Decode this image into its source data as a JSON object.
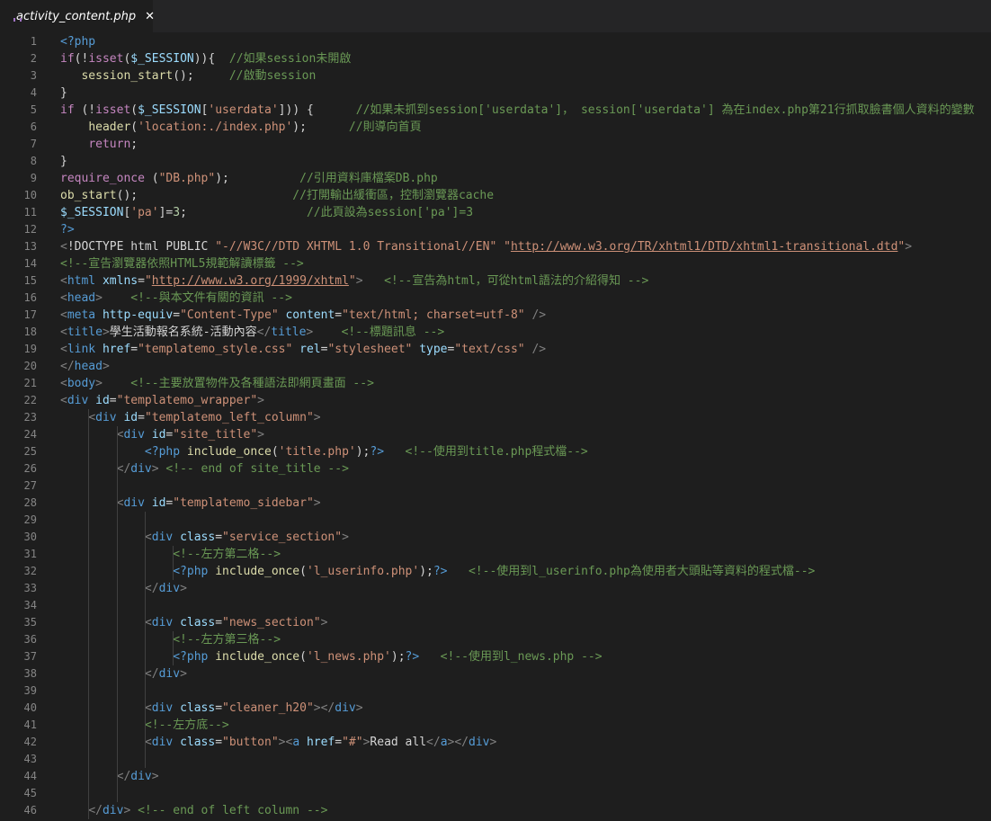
{
  "tab": {
    "title": "activity_content.php",
    "close": "✕",
    "icon": "php-elephant-icon"
  },
  "colors": {
    "background": "#1e1e1e",
    "tabbar": "#252526",
    "comment": "#6a9955",
    "string": "#ce9178",
    "keyword": "#c586c0"
  },
  "lines": [
    {
      "n": "1",
      "segs": [
        [
          "ph",
          "<?php"
        ]
      ]
    },
    {
      "n": "2",
      "segs": [
        [
          "k",
          "if"
        ],
        [
          "p",
          "(!"
        ],
        [
          "k",
          "isset"
        ],
        [
          "p",
          "("
        ],
        [
          "v",
          "$_SESSION"
        ],
        [
          "p",
          "))"
        ],
        [
          "p",
          "{  "
        ],
        [
          "c",
          "//如果session未開啟"
        ]
      ]
    },
    {
      "n": "3",
      "segs": [
        [
          "p",
          "   "
        ],
        [
          "fn",
          "session_start"
        ],
        [
          "p",
          "();     "
        ],
        [
          "c",
          "//啟動session"
        ]
      ]
    },
    {
      "n": "4",
      "segs": [
        [
          "p",
          "}"
        ]
      ]
    },
    {
      "n": "5",
      "segs": [
        [
          "k",
          "if"
        ],
        [
          "p",
          " (!"
        ],
        [
          "k",
          "isset"
        ],
        [
          "p",
          "("
        ],
        [
          "v",
          "$_SESSION"
        ],
        [
          "p",
          "["
        ],
        [
          "s",
          "'userdata'"
        ],
        [
          "p",
          "])) {      "
        ],
        [
          "c",
          "//如果未抓到session['userdata']， session['userdata'] 為在index.php第21行抓取臉書個人資料的變數"
        ]
      ]
    },
    {
      "n": "6",
      "segs": [
        [
          "p",
          "    "
        ],
        [
          "fn",
          "header"
        ],
        [
          "p",
          "("
        ],
        [
          "s",
          "'location:./index.php'"
        ],
        [
          "p",
          ");      "
        ],
        [
          "c",
          "//則導向首頁"
        ]
      ]
    },
    {
      "n": "7",
      "segs": [
        [
          "p",
          "    "
        ],
        [
          "k",
          "return"
        ],
        [
          "p",
          ";"
        ]
      ]
    },
    {
      "n": "8",
      "segs": [
        [
          "p",
          "}"
        ]
      ]
    },
    {
      "n": "9",
      "segs": [
        [
          "k",
          "require_once"
        ],
        [
          "p",
          " ("
        ],
        [
          "s",
          "\"DB.php\""
        ],
        [
          "p",
          ");          "
        ],
        [
          "c",
          "//引用資料庫檔案DB.php"
        ]
      ]
    },
    {
      "n": "10",
      "segs": [
        [
          "fn",
          "ob_start"
        ],
        [
          "p",
          "();                      "
        ],
        [
          "c",
          "//打開輸出緩衝區，控制瀏覽器cache"
        ]
      ]
    },
    {
      "n": "11",
      "segs": [
        [
          "v",
          "$_SESSION"
        ],
        [
          "p",
          "["
        ],
        [
          "s",
          "'pa'"
        ],
        [
          "p",
          "]="
        ],
        [
          "n",
          "3"
        ],
        [
          "p",
          ";                 "
        ],
        [
          "c",
          "//此頁設為session['pa']=3"
        ]
      ]
    },
    {
      "n": "12",
      "segs": [
        [
          "ph",
          "?>"
        ]
      ]
    },
    {
      "n": "13",
      "segs": [
        [
          "g",
          "<"
        ],
        [
          "p",
          "!DOCTYPE html PUBLIC "
        ],
        [
          "s",
          "\"-//W3C//DTD XHTML 1.0 Transitional//EN\""
        ],
        [
          "p",
          " "
        ],
        [
          "s",
          "\""
        ],
        [
          "su",
          "http://www.w3.org/TR/xhtml1/DTD/xhtml1-transitional.dtd"
        ],
        [
          "s",
          "\""
        ],
        [
          "g",
          ">"
        ]
      ]
    },
    {
      "n": "14",
      "segs": [
        [
          "c",
          "<!--宣告瀏覽器依照HTML5規範解讀標籤 -->"
        ]
      ]
    },
    {
      "n": "15",
      "segs": [
        [
          "g",
          "<"
        ],
        [
          "t",
          "html"
        ],
        [
          "p",
          " "
        ],
        [
          "a",
          "xmlns"
        ],
        [
          "p",
          "="
        ],
        [
          "s",
          "\""
        ],
        [
          "su",
          "http://www.w3.org/1999/xhtml"
        ],
        [
          "s",
          "\""
        ],
        [
          "g",
          ">"
        ],
        [
          "p",
          "   "
        ],
        [
          "c",
          "<!--宣告為html，可從html語法的介紹得知 -->"
        ]
      ]
    },
    {
      "n": "16",
      "segs": [
        [
          "g",
          "<"
        ],
        [
          "t",
          "head"
        ],
        [
          "g",
          ">"
        ],
        [
          "p",
          "    "
        ],
        [
          "c",
          "<!--與本文件有關的資訊 -->"
        ]
      ]
    },
    {
      "n": "17",
      "segs": [
        [
          "g",
          "<"
        ],
        [
          "t",
          "meta"
        ],
        [
          "p",
          " "
        ],
        [
          "a",
          "http-equiv"
        ],
        [
          "p",
          "="
        ],
        [
          "s",
          "\"Content-Type\""
        ],
        [
          "p",
          " "
        ],
        [
          "a",
          "content"
        ],
        [
          "p",
          "="
        ],
        [
          "s",
          "\"text/html; charset=utf-8\""
        ],
        [
          "p",
          " "
        ],
        [
          "g",
          "/>"
        ]
      ]
    },
    {
      "n": "18",
      "segs": [
        [
          "g",
          "<"
        ],
        [
          "t",
          "title"
        ],
        [
          "g",
          ">"
        ],
        [
          "p",
          "學生活動報名系統-活動內容"
        ],
        [
          "g",
          "</"
        ],
        [
          "t",
          "title"
        ],
        [
          "g",
          ">"
        ],
        [
          "p",
          "    "
        ],
        [
          "c",
          "<!--標題訊息 -->"
        ]
      ]
    },
    {
      "n": "19",
      "segs": [
        [
          "g",
          "<"
        ],
        [
          "t",
          "link"
        ],
        [
          "p",
          " "
        ],
        [
          "a",
          "href"
        ],
        [
          "p",
          "="
        ],
        [
          "s",
          "\"templatemo_style.css\""
        ],
        [
          "p",
          " "
        ],
        [
          "a",
          "rel"
        ],
        [
          "p",
          "="
        ],
        [
          "s",
          "\"stylesheet\""
        ],
        [
          "p",
          " "
        ],
        [
          "a",
          "type"
        ],
        [
          "p",
          "="
        ],
        [
          "s",
          "\"text/css\""
        ],
        [
          "p",
          " "
        ],
        [
          "g",
          "/>"
        ]
      ]
    },
    {
      "n": "20",
      "segs": [
        [
          "g",
          "</"
        ],
        [
          "t",
          "head"
        ],
        [
          "g",
          ">"
        ]
      ]
    },
    {
      "n": "21",
      "segs": [
        [
          "g",
          "<"
        ],
        [
          "t",
          "body"
        ],
        [
          "g",
          ">"
        ],
        [
          "p",
          "    "
        ],
        [
          "c",
          "<!--主要放置物件及各種語法即網頁畫面 -->"
        ]
      ]
    },
    {
      "n": "22",
      "segs": [
        [
          "g",
          "<"
        ],
        [
          "t",
          "div"
        ],
        [
          "p",
          " "
        ],
        [
          "a",
          "id"
        ],
        [
          "p",
          "="
        ],
        [
          "s",
          "\"templatemo_wrapper\""
        ],
        [
          "g",
          ">"
        ]
      ]
    },
    {
      "n": "23",
      "segs": [
        [
          "p",
          "    "
        ],
        [
          "g",
          "<"
        ],
        [
          "t",
          "div"
        ],
        [
          "p",
          " "
        ],
        [
          "a",
          "id"
        ],
        [
          "p",
          "="
        ],
        [
          "s",
          "\"templatemo_left_column\""
        ],
        [
          "g",
          ">"
        ]
      ]
    },
    {
      "n": "24",
      "segs": [
        [
          "p",
          "        "
        ],
        [
          "g",
          "<"
        ],
        [
          "t",
          "div"
        ],
        [
          "p",
          " "
        ],
        [
          "a",
          "id"
        ],
        [
          "p",
          "="
        ],
        [
          "s",
          "\"site_title\""
        ],
        [
          "g",
          ">"
        ]
      ]
    },
    {
      "n": "25",
      "segs": [
        [
          "p",
          "            "
        ],
        [
          "ph",
          "<?php"
        ],
        [
          "p",
          " "
        ],
        [
          "fn",
          "include_once"
        ],
        [
          "p",
          "("
        ],
        [
          "s",
          "'title.php'"
        ],
        [
          "p",
          ");"
        ],
        [
          "ph",
          "?>"
        ],
        [
          "p",
          "   "
        ],
        [
          "c",
          "<!--使用到title.php程式檔-->"
        ]
      ]
    },
    {
      "n": "26",
      "segs": [
        [
          "p",
          "        "
        ],
        [
          "g",
          "</"
        ],
        [
          "t",
          "div"
        ],
        [
          "g",
          ">"
        ],
        [
          "p",
          " "
        ],
        [
          "c",
          "<!-- end of site_title -->"
        ]
      ]
    },
    {
      "n": "27",
      "segs": []
    },
    {
      "n": "28",
      "segs": [
        [
          "p",
          "        "
        ],
        [
          "g",
          "<"
        ],
        [
          "t",
          "div"
        ],
        [
          "p",
          " "
        ],
        [
          "a",
          "id"
        ],
        [
          "p",
          "="
        ],
        [
          "s",
          "\"templatemo_sidebar\""
        ],
        [
          "g",
          ">"
        ]
      ]
    },
    {
      "n": "29",
      "segs": []
    },
    {
      "n": "30",
      "segs": [
        [
          "p",
          "            "
        ],
        [
          "g",
          "<"
        ],
        [
          "t",
          "div"
        ],
        [
          "p",
          " "
        ],
        [
          "a",
          "class"
        ],
        [
          "p",
          "="
        ],
        [
          "s",
          "\"service_section\""
        ],
        [
          "g",
          ">"
        ]
      ]
    },
    {
      "n": "31",
      "segs": [
        [
          "p",
          "                "
        ],
        [
          "c",
          "<!--左方第二格-->"
        ]
      ]
    },
    {
      "n": "32",
      "segs": [
        [
          "p",
          "                "
        ],
        [
          "ph",
          "<?php"
        ],
        [
          "p",
          " "
        ],
        [
          "fn",
          "include_once"
        ],
        [
          "p",
          "("
        ],
        [
          "s",
          "'l_userinfo.php'"
        ],
        [
          "p",
          ");"
        ],
        [
          "ph",
          "?>"
        ],
        [
          "p",
          "   "
        ],
        [
          "c",
          "<!--使用到l_userinfo.php為使用者大頭貼等資料的程式檔-->"
        ]
      ]
    },
    {
      "n": "33",
      "segs": [
        [
          "p",
          "            "
        ],
        [
          "g",
          "</"
        ],
        [
          "t",
          "div"
        ],
        [
          "g",
          ">"
        ]
      ]
    },
    {
      "n": "34",
      "segs": []
    },
    {
      "n": "35",
      "segs": [
        [
          "p",
          "            "
        ],
        [
          "g",
          "<"
        ],
        [
          "t",
          "div"
        ],
        [
          "p",
          " "
        ],
        [
          "a",
          "class"
        ],
        [
          "p",
          "="
        ],
        [
          "s",
          "\"news_section\""
        ],
        [
          "g",
          ">"
        ]
      ]
    },
    {
      "n": "36",
      "segs": [
        [
          "p",
          "                "
        ],
        [
          "c",
          "<!--左方第三格-->"
        ]
      ]
    },
    {
      "n": "37",
      "segs": [
        [
          "p",
          "                "
        ],
        [
          "ph",
          "<?php"
        ],
        [
          "p",
          " "
        ],
        [
          "fn",
          "include_once"
        ],
        [
          "p",
          "("
        ],
        [
          "s",
          "'l_news.php'"
        ],
        [
          "p",
          ");"
        ],
        [
          "ph",
          "?>"
        ],
        [
          "p",
          "   "
        ],
        [
          "c",
          "<!--使用到l_news.php -->"
        ]
      ]
    },
    {
      "n": "38",
      "segs": [
        [
          "p",
          "            "
        ],
        [
          "g",
          "</"
        ],
        [
          "t",
          "div"
        ],
        [
          "g",
          ">"
        ]
      ]
    },
    {
      "n": "39",
      "segs": []
    },
    {
      "n": "40",
      "segs": [
        [
          "p",
          "            "
        ],
        [
          "g",
          "<"
        ],
        [
          "t",
          "div"
        ],
        [
          "p",
          " "
        ],
        [
          "a",
          "class"
        ],
        [
          "p",
          "="
        ],
        [
          "s",
          "\"cleaner_h20\""
        ],
        [
          "g",
          ">"
        ],
        [
          "g",
          "</"
        ],
        [
          "t",
          "div"
        ],
        [
          "g",
          ">"
        ]
      ]
    },
    {
      "n": "41",
      "segs": [
        [
          "p",
          "            "
        ],
        [
          "c",
          "<!--左方底-->"
        ]
      ]
    },
    {
      "n": "42",
      "segs": [
        [
          "p",
          "            "
        ],
        [
          "g",
          "<"
        ],
        [
          "t",
          "div"
        ],
        [
          "p",
          " "
        ],
        [
          "a",
          "class"
        ],
        [
          "p",
          "="
        ],
        [
          "s",
          "\"button\""
        ],
        [
          "g",
          ">"
        ],
        [
          "g",
          "<"
        ],
        [
          "t",
          "a"
        ],
        [
          "p",
          " "
        ],
        [
          "a",
          "href"
        ],
        [
          "p",
          "="
        ],
        [
          "s",
          "\"#\""
        ],
        [
          "g",
          ">"
        ],
        [
          "p",
          "Read all"
        ],
        [
          "g",
          "</"
        ],
        [
          "t",
          "a"
        ],
        [
          "g",
          ">"
        ],
        [
          "g",
          "</"
        ],
        [
          "t",
          "div"
        ],
        [
          "g",
          ">"
        ]
      ]
    },
    {
      "n": "43",
      "segs": []
    },
    {
      "n": "44",
      "segs": [
        [
          "p",
          "        "
        ],
        [
          "g",
          "</"
        ],
        [
          "t",
          "div"
        ],
        [
          "g",
          ">"
        ]
      ]
    },
    {
      "n": "45",
      "segs": []
    },
    {
      "n": "46",
      "segs": [
        [
          "p",
          "    "
        ],
        [
          "g",
          "</"
        ],
        [
          "t",
          "div"
        ],
        [
          "g",
          ">"
        ],
        [
          "p",
          " "
        ],
        [
          "c",
          "<!-- end of left column -->"
        ]
      ]
    }
  ]
}
